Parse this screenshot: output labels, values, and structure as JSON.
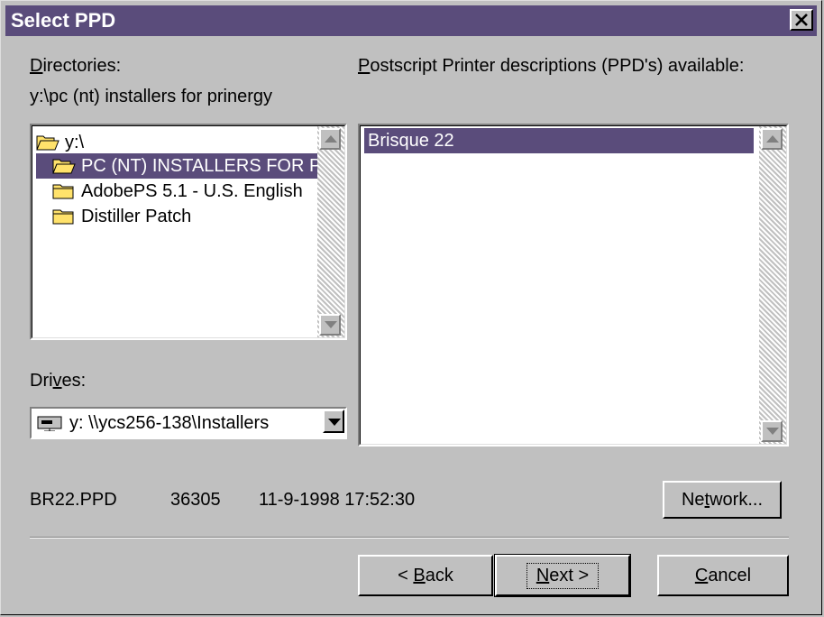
{
  "window": {
    "title": "Select PPD",
    "close_symbol": "×"
  },
  "directories": {
    "label_accel": "D",
    "label_rest": "irectories:",
    "current_path": "y:\\pc (nt) installers for prinergy",
    "items": [
      {
        "label": "y:\\",
        "icon": "open-folder-icon"
      },
      {
        "label": "PC (NT) INSTALLERS FOR PRINERGY",
        "icon": "open-folder-icon",
        "selected": true
      },
      {
        "label": "AdobePS 5.1 - U.S. English",
        "icon": "folder-icon"
      },
      {
        "label": "Distiller Patch",
        "icon": "folder-icon"
      }
    ]
  },
  "ppd": {
    "label_accel": "P",
    "label_rest": "ostscript Printer descriptions (PPD's) available:",
    "items": [
      {
        "label": "Brisque 22",
        "selected": true
      }
    ]
  },
  "drives": {
    "label_pre": "Dri",
    "label_accel": "v",
    "label_post": "es:",
    "value": "y: \\\\ycs256-138\\Installers",
    "icon": "network-drive-icon"
  },
  "file_info": {
    "name": "BR22.PPD",
    "size": "36305",
    "date": "11-9-1998 17:52:30"
  },
  "buttons": {
    "network": {
      "pre": "Ne",
      "accel": "t",
      "post": "work..."
    },
    "back": {
      "pre": "< ",
      "accel": "B",
      "post": "ack"
    },
    "next": {
      "pre": "",
      "accel": "N",
      "post": "ext >"
    },
    "cancel": {
      "pre": "",
      "accel": "C",
      "post": "ancel"
    }
  },
  "colors": {
    "titlebar": "#5a4c7b",
    "selection": "#5a4c7b",
    "face": "#c0c0c0",
    "folder": "#ffe26b"
  }
}
